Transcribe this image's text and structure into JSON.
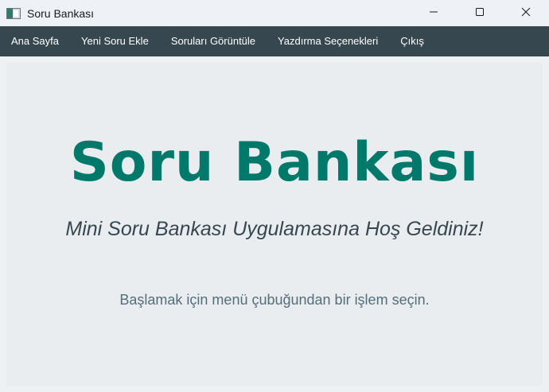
{
  "window": {
    "title": "Soru Bankası"
  },
  "menu": {
    "items": [
      {
        "label": "Ana Sayfa"
      },
      {
        "label": "Yeni Soru Ekle"
      },
      {
        "label": "Soruları Görüntüle"
      },
      {
        "label": "Yazdırma Seçenekleri"
      },
      {
        "label": "Çıkış"
      }
    ]
  },
  "main": {
    "title": "Soru Bankası",
    "subtitle": "Mini Soru Bankası Uygulamasına Hoş Geldiniz!",
    "hint": "Başlamak için menü çubuğundan bir işlem seçin."
  },
  "icons": {
    "app": "app-icon",
    "minimize": "minimize-icon",
    "maximize": "maximize-icon",
    "close": "close-icon"
  },
  "colors": {
    "menubar": "#37474f",
    "title_accent": "#00796b",
    "subtitle": "#37474f",
    "hint": "#546e7a",
    "content_bg": "#e9edf0"
  }
}
